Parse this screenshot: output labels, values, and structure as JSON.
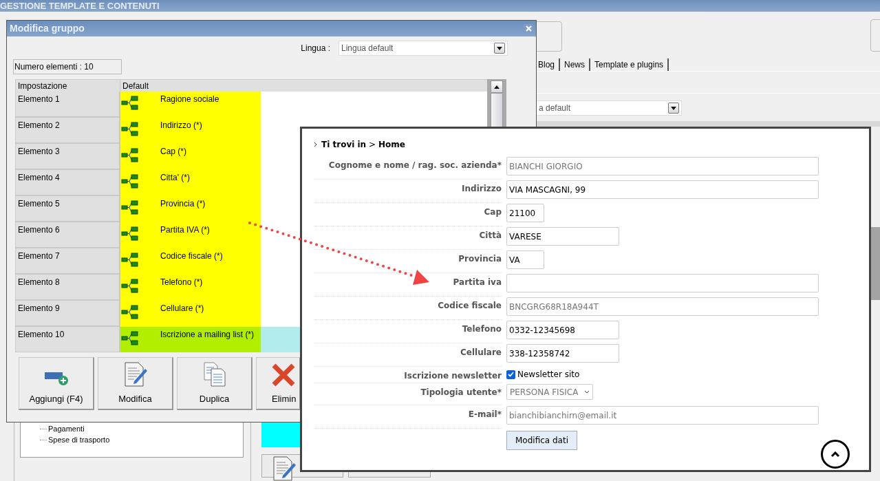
{
  "app_title": "GESTIONE TEMPLATE E CONTENUTI",
  "background": {
    "tabs": [
      {
        "label": "Blog"
      },
      {
        "label": "News"
      },
      {
        "label": "Template e plugins"
      }
    ],
    "language_select": {
      "value": "a default"
    },
    "tree_items": [
      "Pagamenti",
      "Spese di trasporto"
    ]
  },
  "dialog": {
    "title": "Modifica gruppo",
    "language_label": "Lingua :",
    "language_select": {
      "value": "Lingua default"
    },
    "count": "Numero elementi : 10",
    "columns": [
      "Impostazione",
      "Default"
    ],
    "rows": [
      {
        "setting": "Elemento 1",
        "value": "Ragione sociale",
        "selected": false
      },
      {
        "setting": "Elemento 2",
        "value": "Indirizzo (*)",
        "selected": false
      },
      {
        "setting": "Elemento 3",
        "value": "Cap (*)",
        "selected": false
      },
      {
        "setting": "Elemento 4",
        "value": "Citta' (*)",
        "selected": false
      },
      {
        "setting": "Elemento 5",
        "value": "Provincia (*)",
        "selected": false
      },
      {
        "setting": "Elemento 6",
        "value": "Partita IVA (*)",
        "selected": false
      },
      {
        "setting": "Elemento 7",
        "value": "Codice fiscale (*)",
        "selected": false
      },
      {
        "setting": "Elemento 8",
        "value": "Telefono (*)",
        "selected": false
      },
      {
        "setting": "Elemento 9",
        "value": "Cellulare (*)",
        "selected": false
      },
      {
        "setting": "Elemento 10",
        "value": "Iscrizione a mailing list (*)",
        "selected": true
      }
    ],
    "buttons": [
      {
        "label": "Aggiungi (F4)",
        "kind": "add"
      },
      {
        "label": "Modifica",
        "kind": "edit"
      },
      {
        "label": "Duplica",
        "kind": "duplicate"
      },
      {
        "label": "Elimin",
        "kind": "delete"
      }
    ]
  },
  "form_panel": {
    "breadcrumb": {
      "prefix": "Ti trovi in",
      "separator": ">",
      "current": "Home"
    },
    "fields": [
      {
        "label": "Cognome e nome / rag. soc. azienda*",
        "kind": "text",
        "value": "BIANCHI GIORGIO",
        "disabled": true
      },
      {
        "label": "Indirizzo",
        "kind": "text",
        "value": "VIA MASCAGNI, 99",
        "disabled": false
      },
      {
        "label": "Cap",
        "kind": "text",
        "value": "21100",
        "disabled": false
      },
      {
        "label": "Città",
        "kind": "text",
        "value": "VARESE",
        "disabled": false
      },
      {
        "label": "Provincia",
        "kind": "text",
        "value": "VA",
        "disabled": false
      },
      {
        "label": "Partita iva",
        "kind": "text"
      },
      {
        "label": "Codice fiscale",
        "kind": "text",
        "value": "BNCGRG68R18A944T",
        "disabled": true
      },
      {
        "label": "Telefono",
        "kind": "text",
        "value": "0332-12345698",
        "disabled": false
      },
      {
        "label": "Cellulare",
        "kind": "text",
        "value": "338-12358742",
        "disabled": false
      },
      {
        "label": "Iscrizione newsletter",
        "kind": "checkbox",
        "value": "Newsletter sito",
        "checked": true
      },
      {
        "label": "Tipologia utente*",
        "kind": "select",
        "value": "PERSONA FISICA",
        "disabled": true
      },
      {
        "label": "E-mail*",
        "kind": "text",
        "value": "bianchibianchirn@email.it",
        "disabled": true
      }
    ],
    "submit": "Modifica dati"
  }
}
